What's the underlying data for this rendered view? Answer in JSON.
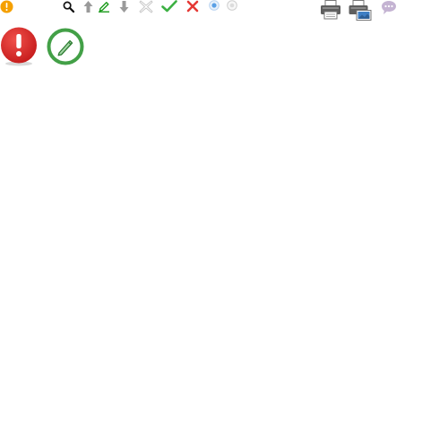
{
  "toolbar": {
    "icons": [
      {
        "name": "warning-icon",
        "color": "#f5a000"
      },
      {
        "name": "search-icon",
        "color": "#111111"
      },
      {
        "name": "move-up-icon",
        "color": "#9a9a9a"
      },
      {
        "name": "edit-icon",
        "color": "#1a9a1a"
      },
      {
        "name": "move-down-icon",
        "color": "#9a9a9a"
      },
      {
        "name": "delete-disabled-icon",
        "color": "#c8c8c8"
      },
      {
        "name": "accept-icon",
        "color": "#3cb043"
      },
      {
        "name": "reject-icon",
        "color": "#e53935"
      },
      {
        "name": "radio-selected-icon",
        "color": "#5aa0e6"
      },
      {
        "name": "radio-unselected-icon",
        "color": "#bbbbbb"
      },
      {
        "name": "print-icon",
        "color": "#666666"
      },
      {
        "name": "print-preview-icon",
        "color": "#666666"
      },
      {
        "name": "comment-icon",
        "color": "#b9a6c8"
      }
    ]
  },
  "large_icons": [
    {
      "name": "error-large-icon",
      "color": "#d32f2f"
    },
    {
      "name": "edit-large-icon",
      "color": "#43a047"
    }
  ]
}
